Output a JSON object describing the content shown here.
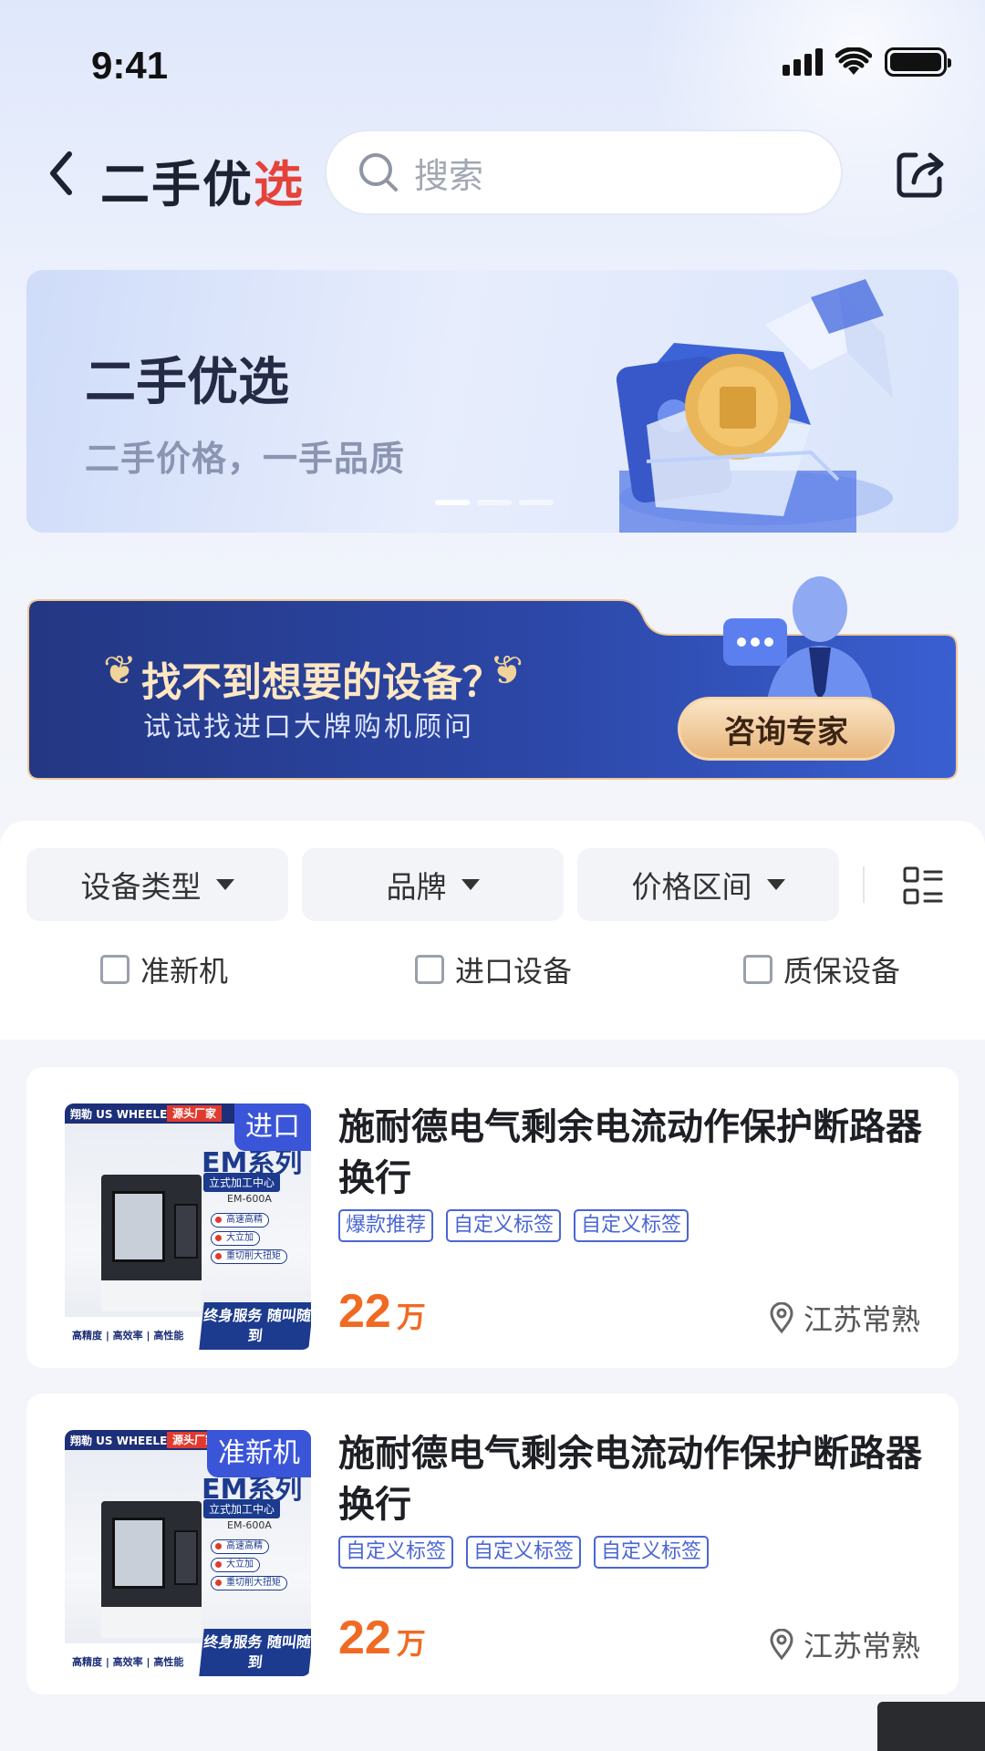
{
  "status_bar": {
    "time": "9:41"
  },
  "nav": {
    "title_prefix": "二手优",
    "title_u": "选",
    "search_placeholder": "搜索"
  },
  "banner": {
    "title": "二手优选",
    "subtitle": "二手价格，一手品质",
    "dots": 3,
    "active_dot": 1
  },
  "consult": {
    "title": "找不到想要的设备？",
    "subtitle": "试试找进口大牌购机顾问",
    "button": "咨询专家"
  },
  "filters": {
    "chips": [
      {
        "label": "设备类型"
      },
      {
        "label": "品牌"
      },
      {
        "label": "价格区间"
      }
    ],
    "checks": [
      {
        "label": "准新机",
        "checked": false
      },
      {
        "label": "进口设备",
        "checked": false
      },
      {
        "label": "质保设备",
        "checked": false
      }
    ]
  },
  "thumb_art": {
    "brand": "翔勒 US WHEELER",
    "source": "源头厂家",
    "series": "EM系列",
    "series_sub": "立式加工中心",
    "model": "EM-600A",
    "features": [
      "高速高精",
      "大立加",
      "重切削大扭矩"
    ],
    "bottom": "高精度 | 高效率 | 高性能",
    "service": "终身服务 随叫随到"
  },
  "products": [
    {
      "corner_tag": "进口",
      "title": "施耐德电气剩余电流动作保护断路器换行",
      "tags": [
        "爆款推荐",
        "自定义标签",
        "自定义标签"
      ],
      "price": "22",
      "price_unit": "万",
      "location": "江苏常熟"
    },
    {
      "corner_tag": "准新机",
      "title": "施耐德电气剩余电流动作保护断路器换行",
      "tags": [
        "自定义标签",
        "自定义标签",
        "自定义标签"
      ],
      "price": "22",
      "price_unit": "万",
      "location": "江苏常熟"
    }
  ],
  "colors": {
    "accent": "#3b55d9",
    "price": "#f06a23",
    "consult_bg": "#24388a",
    "consult_btn": "#e7b57a"
  }
}
